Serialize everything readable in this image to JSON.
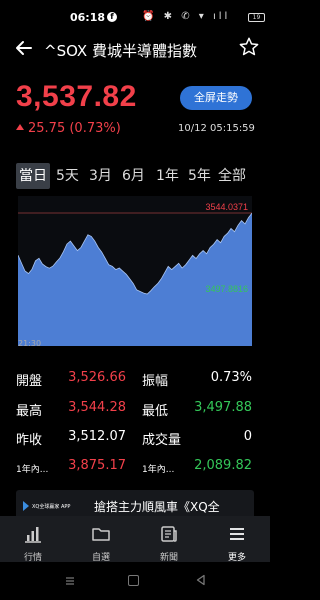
{
  "status_bar": {
    "time": "06:18",
    "facebook_glyph": "f",
    "icons": "⏰ ✱ ✆ ▾ ıll",
    "battery": "19"
  },
  "header": {
    "title": "^SOX 費城半導體指數",
    "back_icon": "arrow-left",
    "favorite_icon": "star-outline"
  },
  "quote": {
    "price": "3,537.82",
    "change": "25.75 (0.73%)",
    "datetime": "10/12 05:15:59",
    "fullscreen_label": "全屏走勢"
  },
  "tabs": [
    {
      "label": "當日",
      "active": true
    },
    {
      "label": "5天",
      "active": false
    },
    {
      "label": "3月",
      "active": false
    },
    {
      "label": "6月",
      "active": false
    },
    {
      "label": "1年",
      "active": false
    },
    {
      "label": "5年",
      "active": false
    },
    {
      "label": "全部",
      "active": false
    }
  ],
  "chart_data": {
    "type": "area",
    "high_label": "3544.0371",
    "low_label": "3497.8816",
    "x_tick": "21:30",
    "ylim": [
      3497.8816,
      3544.0371
    ],
    "values": [
      3520.0,
      3515.5,
      3511.0,
      3509.5,
      3512.0,
      3516.8,
      3518.2,
      3515.0,
      3513.5,
      3512.6,
      3513.8,
      3516.2,
      3518.4,
      3522.0,
      3526.3,
      3528.0,
      3525.3,
      3522.6,
      3524.4,
      3528.0,
      3531.6,
      3530.7,
      3528.0,
      3524.4,
      3521.7,
      3518.1,
      3514.5,
      3513.6,
      3511.8,
      3512.7,
      3510.9,
      3509.1,
      3506.5,
      3503.8,
      3500.2,
      3499.3,
      3498.4,
      3497.9,
      3499.7,
      3501.9,
      3503.8,
      3506.5,
      3510.0,
      3513.6,
      3511.8,
      3513.6,
      3515.4,
      3512.7,
      3514.5,
      3517.2,
      3519.9,
      3518.1,
      3520.8,
      3522.6,
      3520.8,
      3524.4,
      3526.2,
      3528.9,
      3527.1,
      3530.7,
      3532.5,
      3535.2,
      3533.4,
      3537.0,
      3539.7,
      3537.8,
      3541.4,
      3544.0
    ]
  },
  "stats": {
    "open_label": "開盤",
    "open_value": "3,526.66",
    "amplitude_label": "振幅",
    "amplitude_value": "0.73%",
    "high_label": "最高",
    "high_value": "3,544.28",
    "low_label": "最低",
    "low_value": "3,497.88",
    "prev_close_label": "昨收",
    "prev_close_value": "3,512.07",
    "volume_label": "成交量",
    "volume_value": "0",
    "year_high_label": "1年內...",
    "year_high_value": "3,875.17",
    "year_low_label": "1年內...",
    "year_low_value": "2,089.82"
  },
  "ad": {
    "logo_text": "XQ全球贏家 APP",
    "headline": "搶搭主力順風車《XQ全"
  },
  "bottom_nav": [
    {
      "label": "行情",
      "icon": "chart-bars"
    },
    {
      "label": "自選",
      "icon": "folder"
    },
    {
      "label": "新聞",
      "icon": "newspaper"
    },
    {
      "label": "更多",
      "icon": "menu"
    }
  ],
  "colors": {
    "up": "#f2404a",
    "down": "#34c759",
    "accent": "#2f73d6",
    "chart_fill": "#4d7ed4"
  }
}
